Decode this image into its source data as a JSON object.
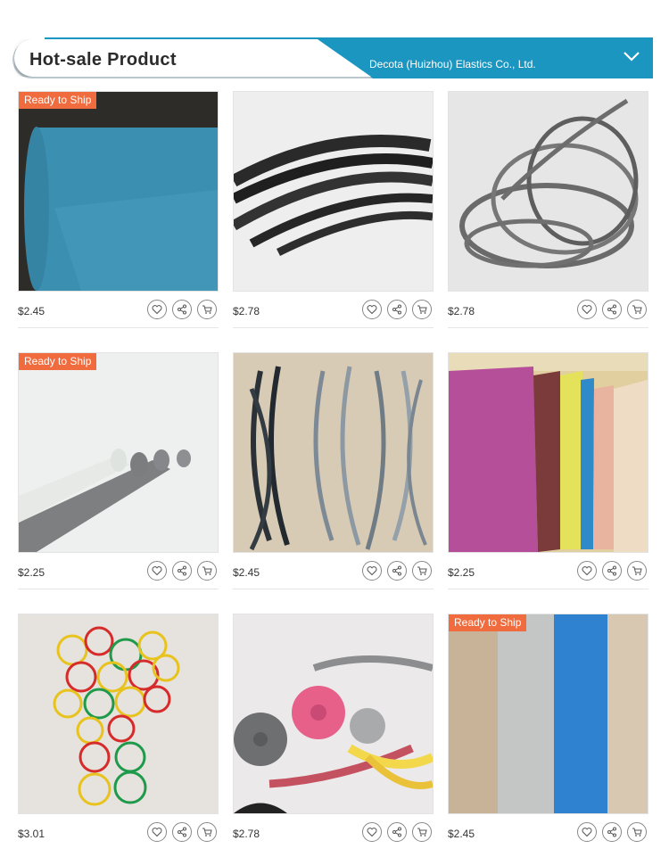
{
  "header": {
    "title": "Hot-sale Product",
    "company": "Decota (Huizhou) Elastics Co., Ltd.",
    "toggle_icon": "chevron-down-icon"
  },
  "badge_label": "Ready to Ship",
  "colors": {
    "banner": "#1a96c0",
    "badge": "#f06b3d"
  },
  "products": [
    {
      "price": "$2.45",
      "ready_to_ship": true,
      "image": "blue-perforated-elastic-roll"
    },
    {
      "price": "$2.78",
      "ready_to_ship": false,
      "image": "black-rubber-bands"
    },
    {
      "price": "$2.78",
      "ready_to_ship": false,
      "image": "gray-rubber-strips"
    },
    {
      "price": "$2.25",
      "ready_to_ship": true,
      "image": "white-gray-rubber-tapes"
    },
    {
      "price": "$2.45",
      "ready_to_ship": false,
      "image": "black-silver-elastic-loops"
    },
    {
      "price": "$2.25",
      "ready_to_ship": false,
      "image": "colored-rubber-sheets"
    },
    {
      "price": "$3.01",
      "ready_to_ship": false,
      "image": "multicolor-rubber-bands"
    },
    {
      "price": "$2.78",
      "ready_to_ship": false,
      "image": "colored-elastic-tape-rolls"
    },
    {
      "price": "$2.45",
      "ready_to_ship": true,
      "image": "gray-blue-rubber-sheets"
    }
  ]
}
